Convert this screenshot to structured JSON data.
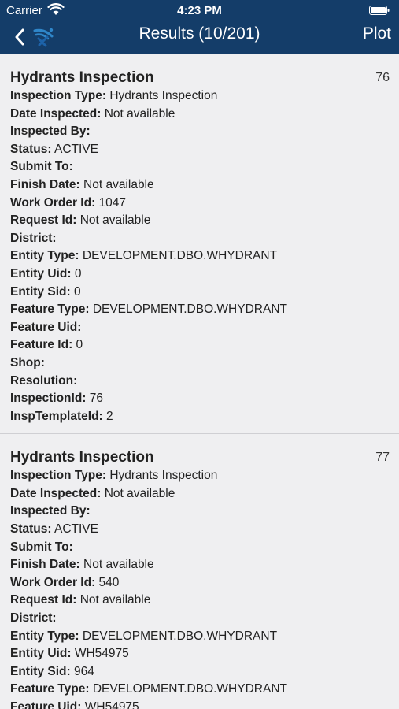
{
  "status_bar": {
    "carrier": "Carrier",
    "time": "4:23 PM"
  },
  "navbar": {
    "title": "Results (10/201)",
    "plot_label": "Plot",
    "back_icon": "chevron-left-icon",
    "logo_icon": "app-logo-icon"
  },
  "colors": {
    "header_background": "#143d69",
    "list_background": "#efeff1"
  },
  "results": [
    {
      "title": "Hydrants Inspection",
      "id": "76",
      "fields": [
        {
          "label": "Inspection Type:",
          "value": "Hydrants Inspection"
        },
        {
          "label": "Date Inspected:",
          "value": "Not available"
        },
        {
          "label": "Inspected By:",
          "value": ""
        },
        {
          "label": "Status:",
          "value": "ACTIVE"
        },
        {
          "label": "Submit To:",
          "value": ""
        },
        {
          "label": "Finish Date:",
          "value": "Not available"
        },
        {
          "label": "Work Order Id:",
          "value": "1047"
        },
        {
          "label": "Request Id:",
          "value": "Not available"
        },
        {
          "label": "District:",
          "value": ""
        },
        {
          "label": "Entity Type:",
          "value": "DEVELOPMENT.DBO.WHYDRANT"
        },
        {
          "label": "Entity Uid:",
          "value": "0"
        },
        {
          "label": "Entity Sid:",
          "value": "0"
        },
        {
          "label": "Feature Type:",
          "value": "DEVELOPMENT.DBO.WHYDRANT"
        },
        {
          "label": "Feature Uid:",
          "value": ""
        },
        {
          "label": "Feature Id:",
          "value": "0"
        },
        {
          "label": "Shop:",
          "value": ""
        },
        {
          "label": "Resolution:",
          "value": ""
        },
        {
          "label": "InspectionId:",
          "value": "76"
        },
        {
          "label": "InspTemplateId:",
          "value": "2"
        }
      ]
    },
    {
      "title": "Hydrants Inspection",
      "id": "77",
      "fields": [
        {
          "label": "Inspection Type:",
          "value": "Hydrants Inspection"
        },
        {
          "label": "Date Inspected:",
          "value": "Not available"
        },
        {
          "label": "Inspected By:",
          "value": ""
        },
        {
          "label": "Status:",
          "value": "ACTIVE"
        },
        {
          "label": "Submit To:",
          "value": ""
        },
        {
          "label": "Finish Date:",
          "value": "Not available"
        },
        {
          "label": "Work Order Id:",
          "value": "540"
        },
        {
          "label": "Request Id:",
          "value": "Not available"
        },
        {
          "label": "District:",
          "value": ""
        },
        {
          "label": "Entity Type:",
          "value": "DEVELOPMENT.DBO.WHYDRANT"
        },
        {
          "label": "Entity Uid:",
          "value": "WH54975"
        },
        {
          "label": "Entity Sid:",
          "value": "964"
        },
        {
          "label": "Feature Type:",
          "value": "DEVELOPMENT.DBO.WHYDRANT"
        },
        {
          "label": "Feature Uid:",
          "value": "WH54975"
        }
      ]
    }
  ]
}
